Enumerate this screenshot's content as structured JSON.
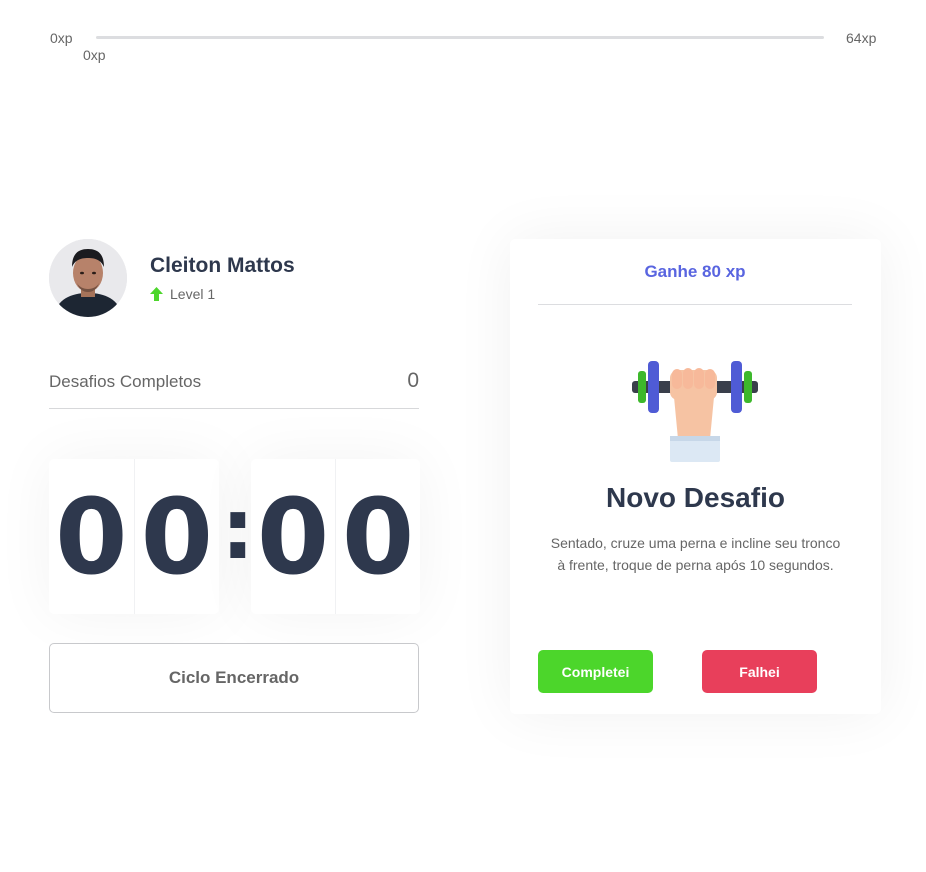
{
  "xp_bar": {
    "min_label": "0xp",
    "max_label": "64xp",
    "current_label": "0xp",
    "progress_fraction": 0,
    "track_color": "#dcdde0",
    "fill_color": "#4cd62b"
  },
  "profile": {
    "name": "Cleiton Mattos",
    "level_label": "Level 1",
    "level_icon": "level-up-arrow-icon",
    "level_icon_color": "#4cd62b"
  },
  "completed_challenges": {
    "label": "Desafios Completos",
    "count": "0"
  },
  "countdown": {
    "minute_left": "0",
    "minute_right": "0",
    "separator": ":",
    "second_left": "0",
    "second_right": "0"
  },
  "cycle_button": {
    "label": "Ciclo Encerrado"
  },
  "challenge_card": {
    "header": "Ganhe 80 xp",
    "icon": "dumbbell-icon",
    "title": "Novo Desafio",
    "description": "Sentado, cruze uma perna e incline seu tronco à frente, troque de perna após 10 segundos.",
    "success_button": "Completei",
    "fail_button": "Falhei"
  },
  "colors": {
    "title": "#2e384d",
    "text": "#666666",
    "blue": "#5965e0",
    "green": "#4cd62b",
    "red": "#e83f5b"
  }
}
